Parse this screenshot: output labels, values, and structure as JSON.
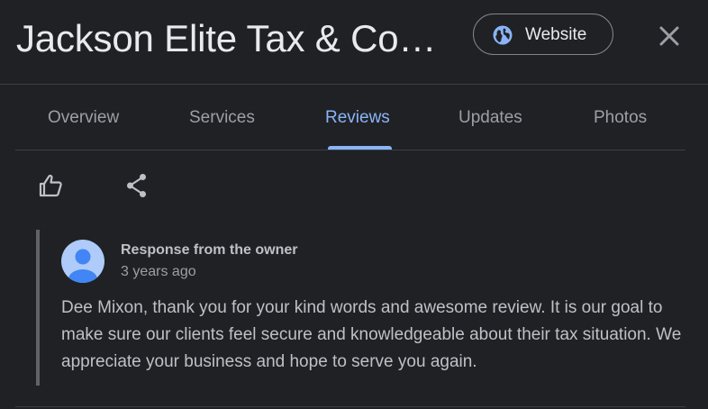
{
  "header": {
    "title": "Jackson Elite Tax & Con...",
    "website_label": "Website"
  },
  "tabs": [
    {
      "label": "Overview",
      "active": false
    },
    {
      "label": "Services",
      "active": false
    },
    {
      "label": "Reviews",
      "active": true
    },
    {
      "label": "Updates",
      "active": false
    },
    {
      "label": "Photos",
      "active": false
    }
  ],
  "actions": {
    "like_icon": "thumbs-up-icon",
    "share_icon": "share-icon"
  },
  "owner_response": {
    "title": "Response from the owner",
    "time": "3 years ago",
    "text": "Dee Mixon, thank you for your kind words and awesome review. It is our goal to make sure our clients feel secure and knowledgeable about their tax situation. We appreciate your business and hope to serve you again."
  },
  "colors": {
    "background": "#202124",
    "accent": "#8ab4f8",
    "text_primary": "#e8eaed",
    "text_secondary": "#9aa0a6"
  }
}
